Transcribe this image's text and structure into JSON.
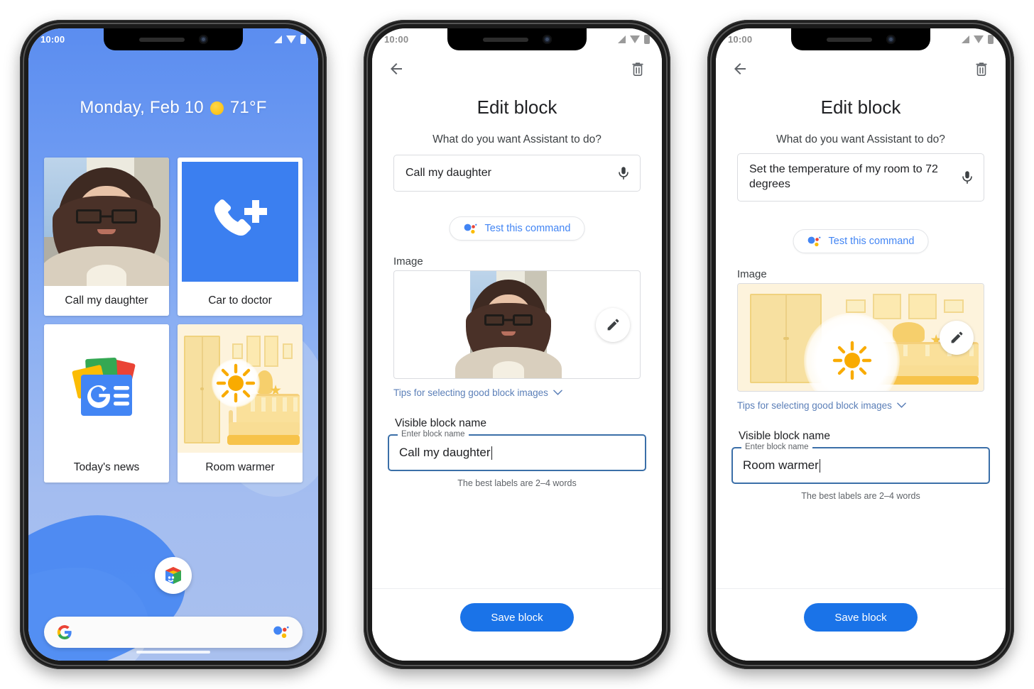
{
  "status_bar": {
    "time": "10:00"
  },
  "phone1": {
    "weather": {
      "date": "Monday, Feb 10",
      "icon": "sun-icon",
      "temperature": "71°F"
    },
    "cards": [
      {
        "label": "Call my daughter",
        "media": "photo-woman"
      },
      {
        "label": "Car to doctor",
        "media": "phone-plus-icon"
      },
      {
        "label": "Today's news",
        "media": "google-news-icon"
      },
      {
        "label": "Room warmer",
        "media": "room-illustration"
      }
    ],
    "dock_app": "blocks-app-icon",
    "search": {
      "logo": "google-g-icon",
      "assistant": "assistant-icon"
    }
  },
  "phone2": {
    "header": {
      "back": "back-arrow-icon",
      "delete": "trash-icon"
    },
    "title": "Edit block",
    "prompt": "What do you want Assistant to do?",
    "command_value": "Call my daughter",
    "mic": "microphone-icon",
    "test_chip": "Test this command",
    "image_label": "Image",
    "image_media": "photo-woman",
    "edit_fab": "pencil-icon",
    "tips": "Tips for selecting good block images",
    "tips_chevron": "chevron-down-icon",
    "visible_block_name_label": "Visible block name",
    "field_float_label": "Enter block name",
    "field_value": "Call my daughter",
    "helper": "The best labels are 2–4 words",
    "save_label": "Save block"
  },
  "phone3": {
    "header": {
      "back": "back-arrow-icon",
      "delete": "trash-icon"
    },
    "title": "Edit block",
    "prompt": "What do you want Assistant to do?",
    "command_value": "Set the temperature of my room to 72 degrees",
    "mic": "microphone-icon",
    "test_chip": "Test this command",
    "image_label": "Image",
    "image_media": "room-illustration",
    "edit_fab": "pencil-icon",
    "tips": "Tips for selecting good block images",
    "tips_chevron": "chevron-down-icon",
    "visible_block_name_label": "Visible block name",
    "field_float_label": "Enter block name",
    "field_value": "Room warmer",
    "helper": "The best labels are 2–4 words",
    "save_label": "Save block"
  },
  "colors": {
    "accent_blue": "#1a73e8",
    "link_blue": "#4285f4",
    "field_border": "#3b6fa8",
    "tile_blue": "#3b7ff0",
    "room_cream": "#fdf3dc",
    "sun_yellow": "#f9ab00"
  }
}
